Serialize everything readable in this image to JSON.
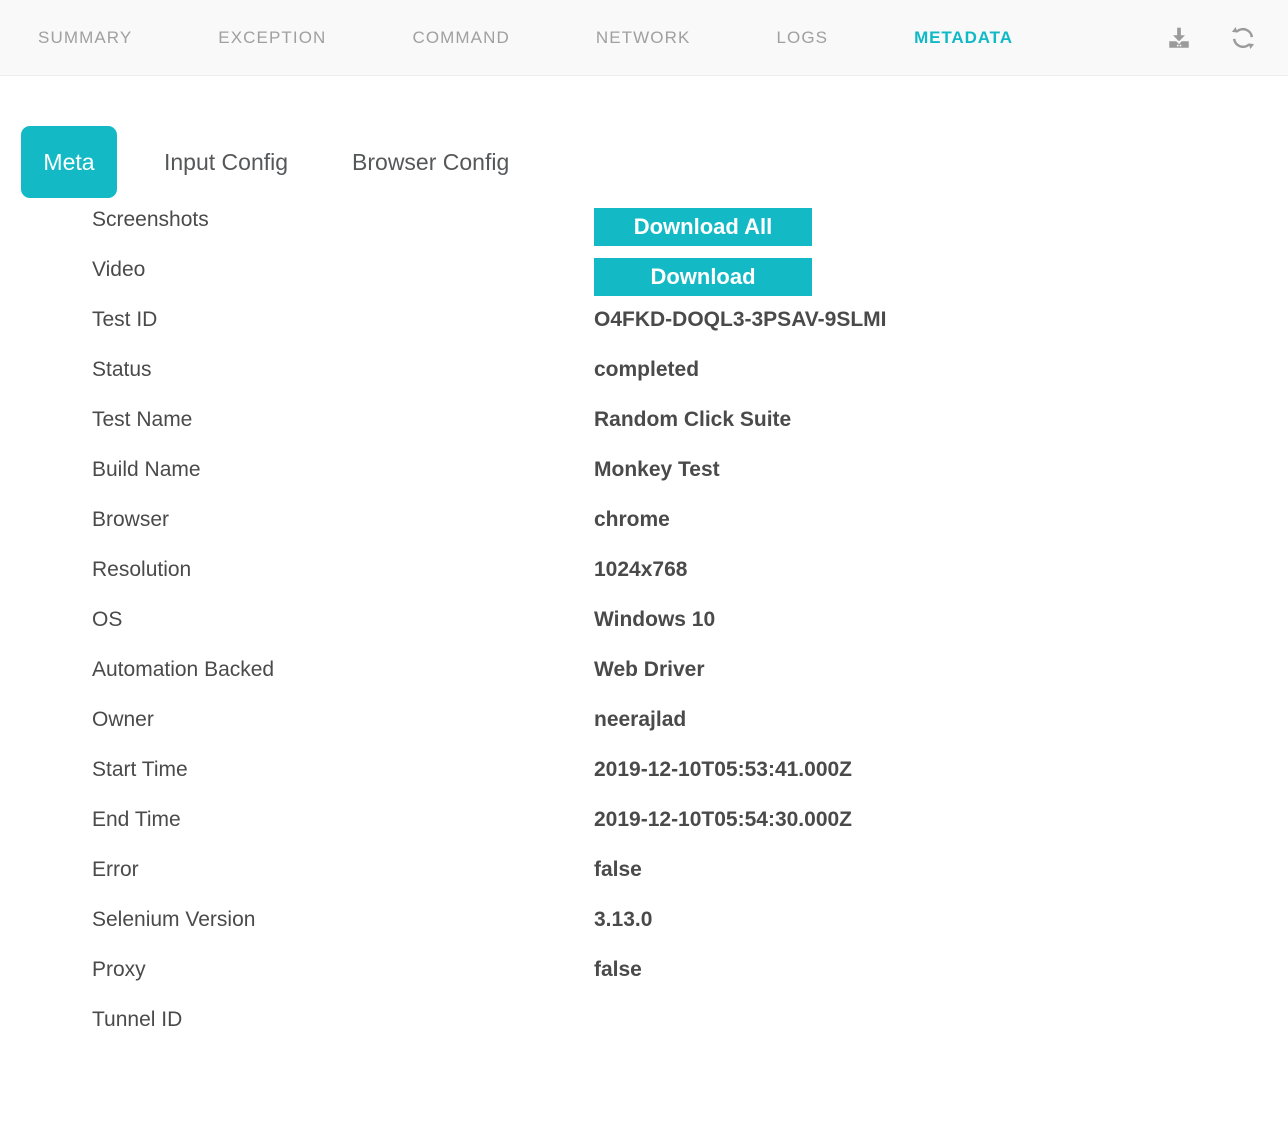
{
  "topnav": {
    "items": [
      {
        "label": "SUMMARY",
        "active": false,
        "name": "summary"
      },
      {
        "label": "EXCEPTION",
        "active": false,
        "name": "exception"
      },
      {
        "label": "COMMAND",
        "active": false,
        "name": "command"
      },
      {
        "label": "NETWORK",
        "active": false,
        "name": "network"
      },
      {
        "label": "LOGS",
        "active": false,
        "name": "logs"
      },
      {
        "label": "METADATA",
        "active": true,
        "name": "metadata"
      }
    ],
    "icons": [
      {
        "name": "download-icon"
      },
      {
        "name": "refresh-icon"
      }
    ],
    "active_color": "#0fb9c6",
    "inactive_color": "#a0a0a0",
    "background": "#f9f9f9"
  },
  "subtabs": [
    {
      "label": "Meta",
      "active": true
    },
    {
      "label": "Input Config",
      "active": false
    },
    {
      "label": "Browser Config",
      "active": false
    }
  ],
  "buttons": {
    "download_all": "Download All",
    "download": "Download",
    "accent": "#13bac6"
  },
  "meta": {
    "rows": [
      {
        "label": "Screenshots",
        "value": ""
      },
      {
        "label": "Video",
        "value": ""
      },
      {
        "label": "Test ID",
        "value": "O4FKD-DOQL3-3PSAV-9SLMI"
      },
      {
        "label": "Status",
        "value": "completed"
      },
      {
        "label": "Test Name",
        "value": "Random Click Suite"
      },
      {
        "label": "Build Name",
        "value": "Monkey Test"
      },
      {
        "label": "Browser",
        "value": "chrome"
      },
      {
        "label": "Resolution",
        "value": "1024x768"
      },
      {
        "label": "OS",
        "value": "Windows 10"
      },
      {
        "label": "Automation Backed",
        "value": "Web Driver"
      },
      {
        "label": "Owner",
        "value": "neerajlad"
      },
      {
        "label": "Start Time",
        "value": "2019-12-10T05:53:41.000Z"
      },
      {
        "label": "End Time",
        "value": "2019-12-10T05:54:30.000Z"
      },
      {
        "label": "Error",
        "value": "false"
      },
      {
        "label": "Selenium Version",
        "value": "3.13.0"
      },
      {
        "label": "Proxy",
        "value": "false"
      },
      {
        "label": "Tunnel ID",
        "value": ""
      }
    ]
  }
}
